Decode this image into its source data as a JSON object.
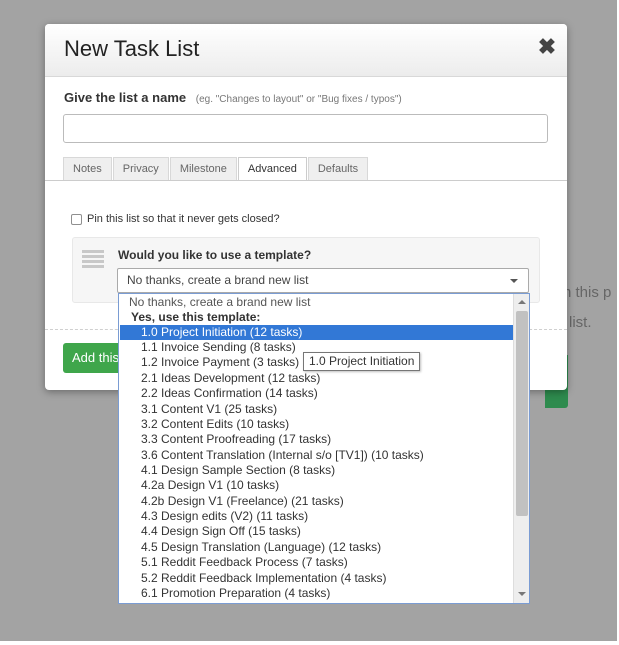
{
  "modal": {
    "title": "New Task List",
    "close_symbol": "✖"
  },
  "name_field": {
    "label": "Give the list a name",
    "hint": "(eg. \"Changes to layout\" or \"Bug fixes / typos\")",
    "value": ""
  },
  "tabs": [
    {
      "label": "Notes",
      "active": false
    },
    {
      "label": "Privacy",
      "active": false
    },
    {
      "label": "Milestone",
      "active": false
    },
    {
      "label": "Advanced",
      "active": true
    },
    {
      "label": "Defaults",
      "active": false
    }
  ],
  "pin": {
    "label": "Pin this list so that it never gets closed?",
    "checked": false
  },
  "template": {
    "question": "Would you like to use a template?",
    "selected_value": "No thanks, create a brand new list",
    "list_icon": "list-icon",
    "caret_icon": "chevron-down-icon"
  },
  "add_button": {
    "label": "Add this"
  },
  "background": {
    "text_line1": "n this p",
    "text_line2": "list."
  },
  "dropdown": {
    "options": [
      {
        "label": "No thanks, create a brand new list",
        "type": "plain"
      },
      {
        "label": "Yes, use this template:",
        "type": "group"
      },
      {
        "label": "1.0 Project Initiation (12 tasks)",
        "type": "item",
        "selected": true
      },
      {
        "label": "1.1 Invoice Sending (8 tasks)",
        "type": "item"
      },
      {
        "label": "1.2 Invoice Payment (3 tasks)",
        "type": "item"
      },
      {
        "label": "2.1 Ideas Development (12 tasks)",
        "type": "item"
      },
      {
        "label": "2.2 Ideas Confirmation (14 tasks)",
        "type": "item"
      },
      {
        "label": "3.1 Content V1 (25 tasks)",
        "type": "item"
      },
      {
        "label": "3.2 Content Edits (10 tasks)",
        "type": "item"
      },
      {
        "label": "3.3 Content Proofreading (17 tasks)",
        "type": "item"
      },
      {
        "label": "3.6 Content Translation (Internal s/o [TV1]) (10 tasks)",
        "type": "item"
      },
      {
        "label": "4.1 Design Sample Section (8 tasks)",
        "type": "item"
      },
      {
        "label": "4.2a Design V1 (10 tasks)",
        "type": "item"
      },
      {
        "label": "4.2b Design V1 (Freelance) (21 tasks)",
        "type": "item"
      },
      {
        "label": "4.3 Design edits (V2) (11 tasks)",
        "type": "item"
      },
      {
        "label": "4.4 Design Sign Off (15 tasks)",
        "type": "item"
      },
      {
        "label": "4.5 Design Translation (Language) (12 tasks)",
        "type": "item"
      },
      {
        "label": "5.1 Reddit Feedback Process (7 tasks)",
        "type": "item"
      },
      {
        "label": "5.2 Reddit Feedback Implementation (4 tasks)",
        "type": "item"
      },
      {
        "label": "6.1 Promotion Preparation (4 tasks)",
        "type": "item"
      }
    ],
    "scroll_up_icon": "scroll-up-arrow-icon",
    "scroll_down_icon": "scroll-down-arrow-icon"
  },
  "tooltip": {
    "text": "1.0 Project Initiation"
  },
  "colors": {
    "overlay": "#a3a3a3",
    "selected_option": "#3278d6",
    "add_button": "#3fa64b"
  }
}
